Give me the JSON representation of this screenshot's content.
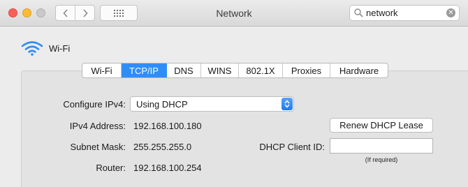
{
  "window": {
    "title": "Network",
    "search": {
      "value": "network",
      "clear_icon": "x-circle-icon"
    }
  },
  "service": {
    "name": "Wi-Fi",
    "icon": "wifi-icon"
  },
  "tabs": [
    {
      "label": "Wi-Fi",
      "active": false
    },
    {
      "label": "TCP/IP",
      "active": true
    },
    {
      "label": "DNS",
      "active": false
    },
    {
      "label": "WINS",
      "active": false
    },
    {
      "label": "802.1X",
      "active": false
    },
    {
      "label": "Proxies",
      "active": false
    },
    {
      "label": "Hardware",
      "active": false
    }
  ],
  "tcpip": {
    "configure_label": "Configure IPv4:",
    "configure_value": "Using DHCP",
    "ipv4_label": "IPv4 Address:",
    "ipv4_value": "192.168.100.180",
    "subnet_label": "Subnet Mask:",
    "subnet_value": "255.255.255.0",
    "router_label": "Router:",
    "router_value": "192.168.100.254",
    "renew_button": "Renew DHCP Lease",
    "client_id_label": "DHCP Client ID:",
    "client_id_value": "",
    "client_id_hint": "(If required)"
  },
  "colors": {
    "accent": "#2f8ef6",
    "close": "#fc5f57",
    "minimize": "#fdbc2e",
    "zoom_disabled": "#c9c9c9"
  }
}
